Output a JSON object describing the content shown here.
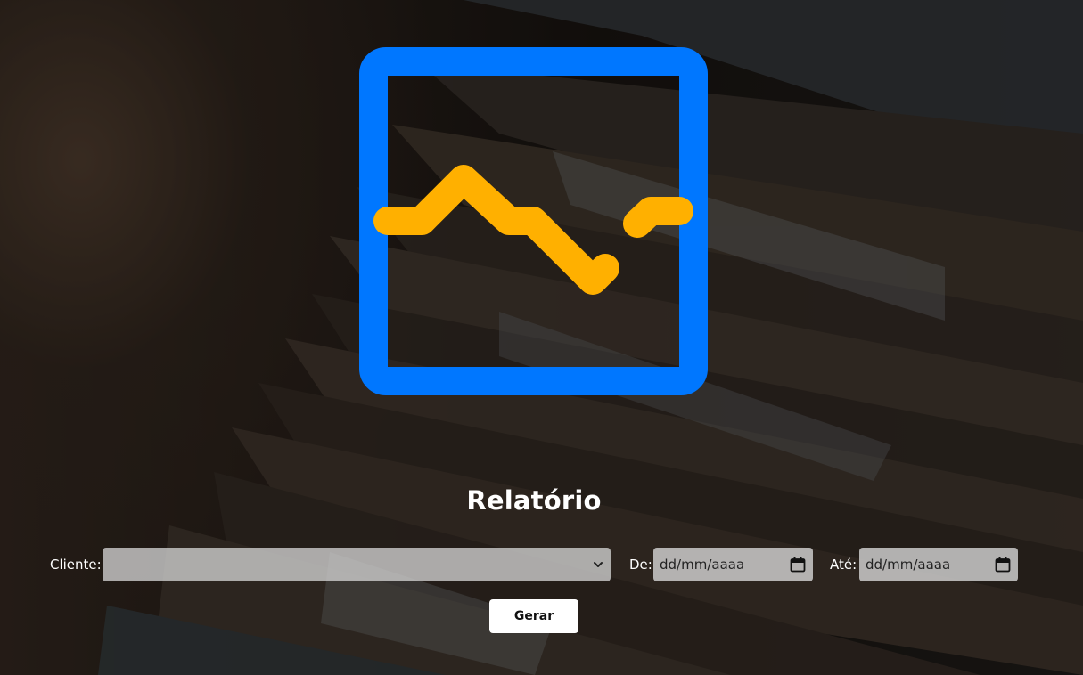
{
  "page": {
    "title": "Relatório"
  },
  "logo": {
    "icon": "report-chart-icon",
    "frame_color": "#0077ff",
    "line_color": "#ffb000"
  },
  "form": {
    "cliente_label": "Cliente:",
    "cliente_value": "",
    "de_label": "De:",
    "de_placeholder": "dd/mm/aaaa",
    "ate_label": "Até:",
    "ate_placeholder": "dd/mm/aaaa",
    "submit_label": "Gerar"
  },
  "icons": {
    "select": "chevron-down-icon",
    "date": "calendar-icon"
  }
}
